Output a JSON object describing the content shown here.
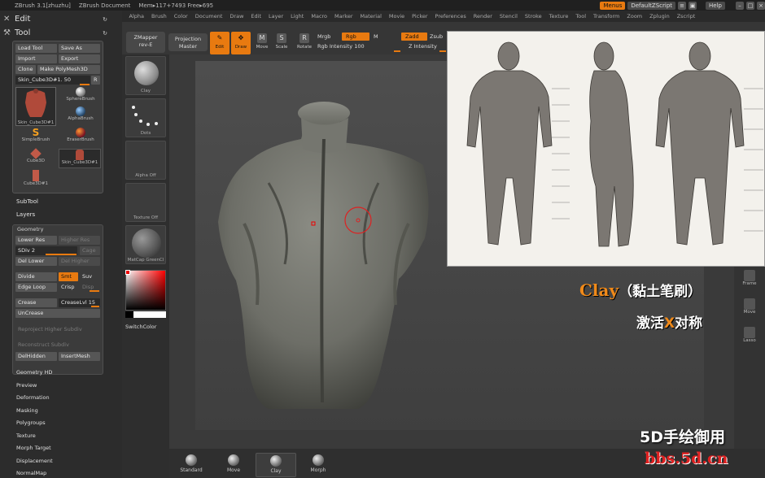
{
  "titlebar": {
    "app": "ZBrush 3.1[zhuzhu]",
    "doc": "ZBrush Document",
    "mem": "Mem▸117+7493 Free▸695",
    "menus_btn": "Menus",
    "script_btn": "DefaultZScript",
    "help_btn": "Help"
  },
  "menubar": [
    "Alpha",
    "Brush",
    "Color",
    "Document",
    "Draw",
    "Edit",
    "Layer",
    "Light",
    "Macro",
    "Marker",
    "Material",
    "Movie",
    "Picker",
    "Preferences",
    "Render",
    "Stencil",
    "Stroke",
    "Texture",
    "Tool",
    "Transform",
    "Zoom",
    "Zplugin",
    "Zscript"
  ],
  "left": {
    "edit_label": "Edit",
    "tool_label": "Tool",
    "load_tool": "Load Tool",
    "save_as": "Save As",
    "import": "Import",
    "export": "Export",
    "clone": "Clone",
    "make_polymesh": "Make PolyMesh3D",
    "tool_slider": "Skin_Cube3D#1. 50",
    "r_btn": "R",
    "thumbs": [
      {
        "label": "Skin_Cube3D#1"
      },
      {
        "label": "SphereBrush"
      },
      {
        "label": "AlphaBrush"
      },
      {
        "label": "SimpleBrush"
      },
      {
        "label": "EraserBrush"
      },
      {
        "label": "Cube3D"
      },
      {
        "label": "Skin_Cube3D#1"
      },
      {
        "label": "Cube3D#1"
      }
    ],
    "subtool": "SubTool",
    "layers": "Layers",
    "geometry": "Geometry",
    "lower_res": "Lower Res",
    "higher_res": "Higher Res",
    "sdiv": "SDiv 2",
    "cage": "Cage",
    "del_lower": "Del Lower",
    "del_higher": "Del Higher",
    "divide": "Divide",
    "smt": "Smt",
    "suv": "Suv",
    "edge_loop": "Edge Loop",
    "crisp": "Crisp",
    "disp": "Disp",
    "crease": "Crease",
    "crease_lvl": "CreaseLvl 15",
    "uncrease": "UnCrease",
    "reproject": "Reproject Higher Subdiv",
    "reconstruct": "Reconstruct Subdiv",
    "delhidden": "DelHidden",
    "insertmesh": "InsertMesh",
    "sections": [
      "Geometry HD",
      "Preview",
      "Deformation",
      "Masking",
      "Polygroups",
      "Texture",
      "Morph Target",
      "Displacement",
      "NormalMap"
    ]
  },
  "shelf": {
    "zmapper": "ZMapper",
    "zmapper_sub": "rev-E",
    "projection": "Projection",
    "projection_sub": "Master",
    "edit": "Edit",
    "draw": "Draw",
    "move": "Move",
    "scale": "Scale",
    "rotate": "Rotate",
    "mrgb": "Mrgb",
    "rgb": "Rgb",
    "m": "M",
    "rgb_intensity": "Rgb Intensity 100",
    "zadd": "Zadd",
    "zsub": "Zsub",
    "z_intensity": "Z Intensity"
  },
  "materials": [
    {
      "label": "Clay"
    },
    {
      "label": "Dots"
    },
    {
      "label": "Alpha Off"
    },
    {
      "label": "Texture Off"
    },
    {
      "label": "MatCap GreenCl"
    }
  ],
  "switchcolor": "SwitchColor",
  "brushes": [
    "Standard",
    "Move",
    "Clay",
    "Morph"
  ],
  "right": [
    "Frame",
    "Move",
    "Lasso"
  ],
  "captions": {
    "clay": "Clay",
    "clay_zh": "（黏土笔刷）",
    "activate_pre": "激活",
    "activate_x": "X",
    "activate_post": "对称",
    "site_zh": "5D手绘御用",
    "site_url": "bbs.5d.cn"
  },
  "colors": {
    "accent": "#e87a10",
    "brand_red": "#e02020"
  }
}
